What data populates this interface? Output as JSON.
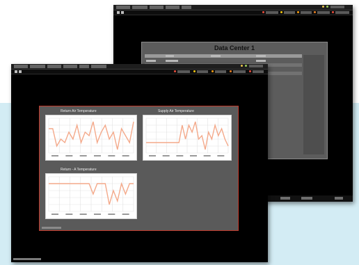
{
  "back_window": {
    "panel_title": "Data Center 1"
  },
  "front_window": {
    "charts": [
      {
        "title": "Return Air Temperature",
        "values": [
          7,
          7,
          2,
          4,
          3,
          6,
          4,
          8,
          3,
          6,
          5,
          9,
          3,
          6,
          8,
          4,
          6,
          1,
          7,
          5,
          3,
          9
        ]
      },
      {
        "title": "Supply Air Temperature",
        "values": [
          3,
          3,
          3,
          3,
          3,
          3,
          3,
          3,
          3,
          3,
          3,
          8,
          4,
          8,
          6,
          9,
          4,
          5,
          1,
          6,
          4,
          8,
          5,
          7,
          4,
          2
        ]
      },
      {
        "title": "Return - A Temperature",
        "values": [
          8,
          8,
          8,
          8,
          8,
          8,
          8,
          8,
          8,
          8,
          8,
          5,
          8,
          8,
          8,
          2,
          6,
          3,
          8,
          5,
          8,
          8
        ]
      }
    ]
  },
  "colors": {
    "window_bg": "#000000",
    "panel_bg": "#5a5a5a",
    "chart_line": "#f4a98a",
    "chart_grid": "#e2e2e2",
    "panel_border": "#c0392b",
    "background_band": "#d3ecf4"
  }
}
